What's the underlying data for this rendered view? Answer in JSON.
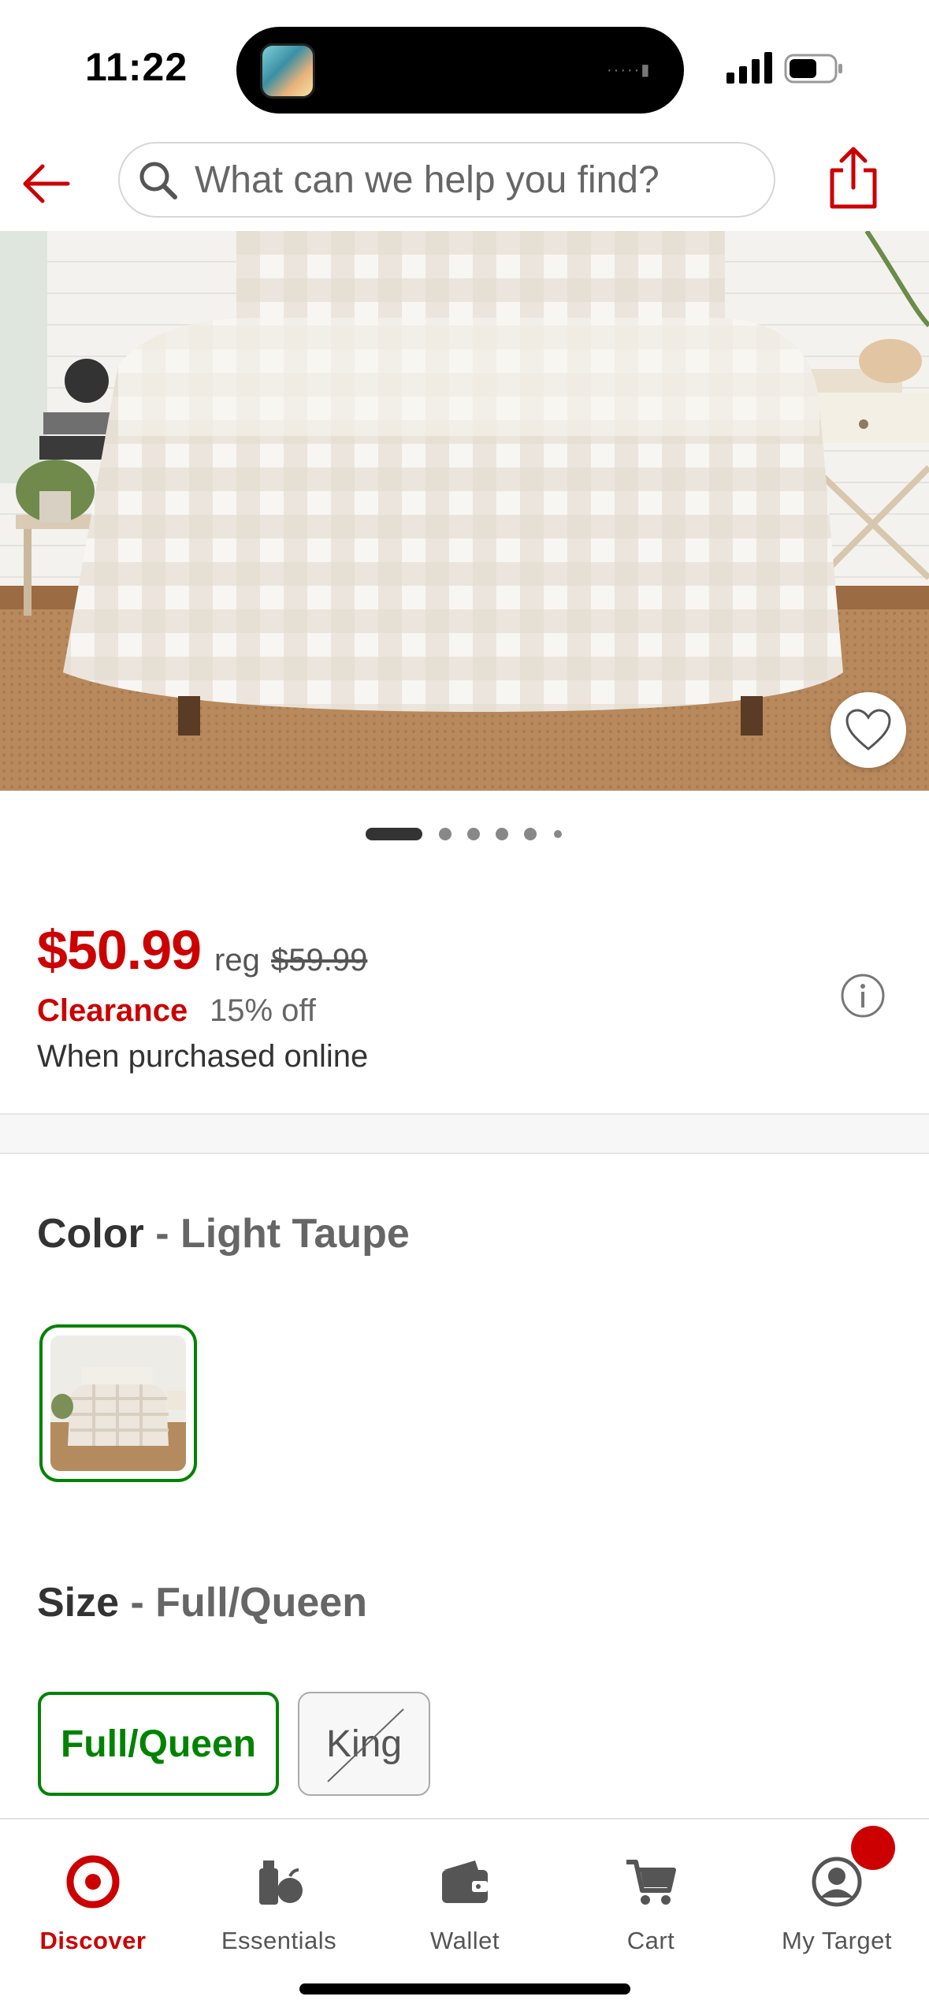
{
  "status_bar": {
    "time": "11:22"
  },
  "search": {
    "placeholder": "What can we help you find?"
  },
  "product": {
    "price": "$50.99",
    "reg_label": "reg",
    "reg_price": "$59.99",
    "clearance_label": "Clearance",
    "discount": "15% off",
    "purchase_note": "When purchased online",
    "image_count": 6,
    "current_image": 1
  },
  "color": {
    "label": "Color",
    "separator": " - ",
    "value": "Light Taupe"
  },
  "size": {
    "label": "Size",
    "separator": " - ",
    "value": "Full/Queen",
    "options": [
      {
        "label": "Full/Queen",
        "selected": true,
        "available": true
      },
      {
        "label": "King",
        "selected": false,
        "available": false
      }
    ]
  },
  "tabs": [
    {
      "label": "Discover",
      "icon": "target-bullseye-icon",
      "active": true
    },
    {
      "label": "Essentials",
      "icon": "essentials-icon",
      "active": false
    },
    {
      "label": "Wallet",
      "icon": "wallet-icon",
      "active": false
    },
    {
      "label": "Cart",
      "icon": "cart-icon",
      "active": false
    },
    {
      "label": "My Target",
      "icon": "account-icon",
      "active": false
    }
  ],
  "colors": {
    "accent": "#cc0000",
    "selected": "#008300",
    "text": "#333333"
  }
}
